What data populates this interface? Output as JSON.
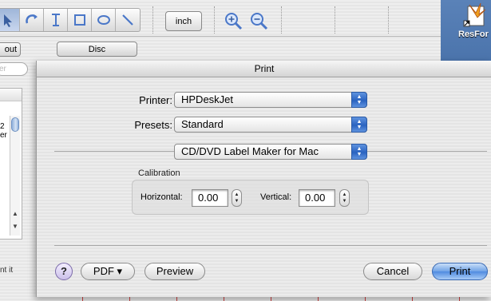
{
  "background_app": {
    "units_button": "inch",
    "layout_tab_fragment": "out",
    "disc_tab": "Disc",
    "search_placeholder_fragment": "er",
    "list_rows": [
      "2",
      "er"
    ],
    "hint_fragment": "nt it"
  },
  "desktop": {
    "icon_label_fragment": "ResFor"
  },
  "print_dialog": {
    "title": "Print",
    "printer_label": "Printer:",
    "printer_value": "HPDeskJet",
    "presets_label": "Presets:",
    "presets_value": "Standard",
    "panel_value": "CD/DVD Label Maker for Mac",
    "calibration": {
      "group_label": "Calibration",
      "horizontal_label": "Horizontal:",
      "horizontal_value": "0.00",
      "vertical_label": "Vertical:",
      "vertical_value": "0.00"
    },
    "buttons": {
      "help": "?",
      "pdf": "PDF ▾",
      "preview": "Preview",
      "cancel": "Cancel",
      "print": "Print"
    }
  },
  "colors": {
    "accent_blue": "#2a63c0",
    "desktop_blue": "#4a73ab",
    "default_button": "#6fa2e6"
  }
}
